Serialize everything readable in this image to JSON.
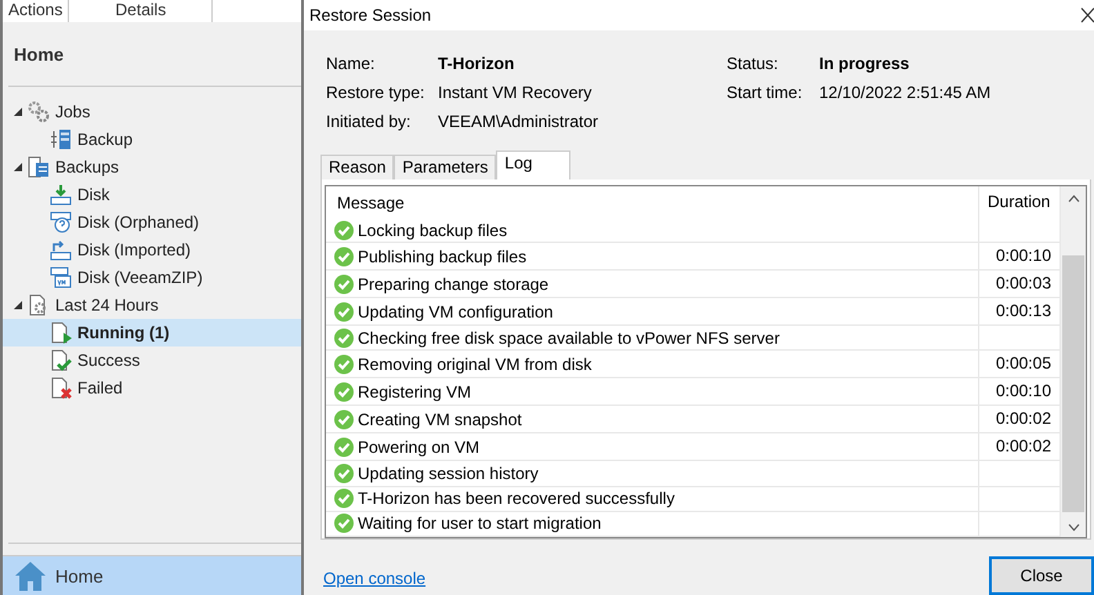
{
  "left_panel": {
    "tabs": [
      {
        "label": "Actions",
        "selected": false
      },
      {
        "label": "Details",
        "selected": false
      }
    ],
    "title": "Home",
    "tree": [
      {
        "label": "Jobs",
        "kind": "jobs",
        "expanded": true,
        "selected": false,
        "children": [
          {
            "label": "Backup",
            "kind": "backup-job",
            "selected": false
          }
        ]
      },
      {
        "label": "Backups",
        "kind": "backups",
        "expanded": true,
        "selected": false,
        "children": [
          {
            "label": "Disk",
            "kind": "disk",
            "selected": false
          },
          {
            "label": "Disk (Orphaned)",
            "kind": "orphaned",
            "selected": false
          },
          {
            "label": "Disk (Imported)",
            "kind": "imported",
            "selected": false
          },
          {
            "label": "Disk (VeeamZIP)",
            "kind": "zip",
            "selected": false
          }
        ]
      },
      {
        "label": "Last 24 Hours",
        "kind": "last",
        "expanded": true,
        "selected": false,
        "children": [
          {
            "label": "Running (1)",
            "kind": "running",
            "selected": true
          },
          {
            "label": "Success",
            "kind": "success",
            "selected": false
          },
          {
            "label": "Failed",
            "kind": "failed",
            "selected": false
          }
        ]
      }
    ],
    "bottom_nav": {
      "label": "Home",
      "selected": true
    }
  },
  "dialog": {
    "title": "Restore Session",
    "details_left": [
      {
        "label": "Name:",
        "value": "T-Horizon",
        "bold": true
      },
      {
        "label": "Restore type:",
        "value": "Instant VM Recovery",
        "bold": false
      },
      {
        "label": "Initiated by:",
        "value": "VEEAM\\Administrator",
        "bold": false
      }
    ],
    "details_right": [
      {
        "label": "Status:",
        "value": "In progress",
        "bold": true
      },
      {
        "label": "Start time:",
        "value": "12/10/2022 2:51:45 AM",
        "bold": false
      }
    ],
    "tabs": [
      {
        "label": "Reason",
        "selected": false
      },
      {
        "label": "Parameters",
        "selected": false
      },
      {
        "label": "Log",
        "selected": true
      }
    ],
    "log": {
      "columns": [
        "Message",
        "Duration"
      ],
      "rows": [
        {
          "message": "Locking backup files"
        },
        {
          "message": "Publishing backup files",
          "duration": "0:00:10"
        },
        {
          "message": "Preparing change storage",
          "duration": "0:00:03"
        },
        {
          "message": "Updating VM configuration",
          "duration": "0:00:13"
        },
        {
          "message": "Checking free disk space available to vPower NFS server"
        },
        {
          "message": "Removing original VM from disk",
          "duration": "0:00:05"
        },
        {
          "message": "Registering VM",
          "duration": "0:00:10"
        },
        {
          "message": "Creating VM snapshot",
          "duration": "0:00:02"
        },
        {
          "message": "Powering on VM",
          "duration": "0:00:02"
        },
        {
          "message": "Updating session history"
        },
        {
          "message": "T-Horizon has been recovered successfully"
        },
        {
          "message": "Waiting for user to start migration"
        }
      ]
    },
    "link": "Open console",
    "buttons": [
      "Close"
    ]
  }
}
